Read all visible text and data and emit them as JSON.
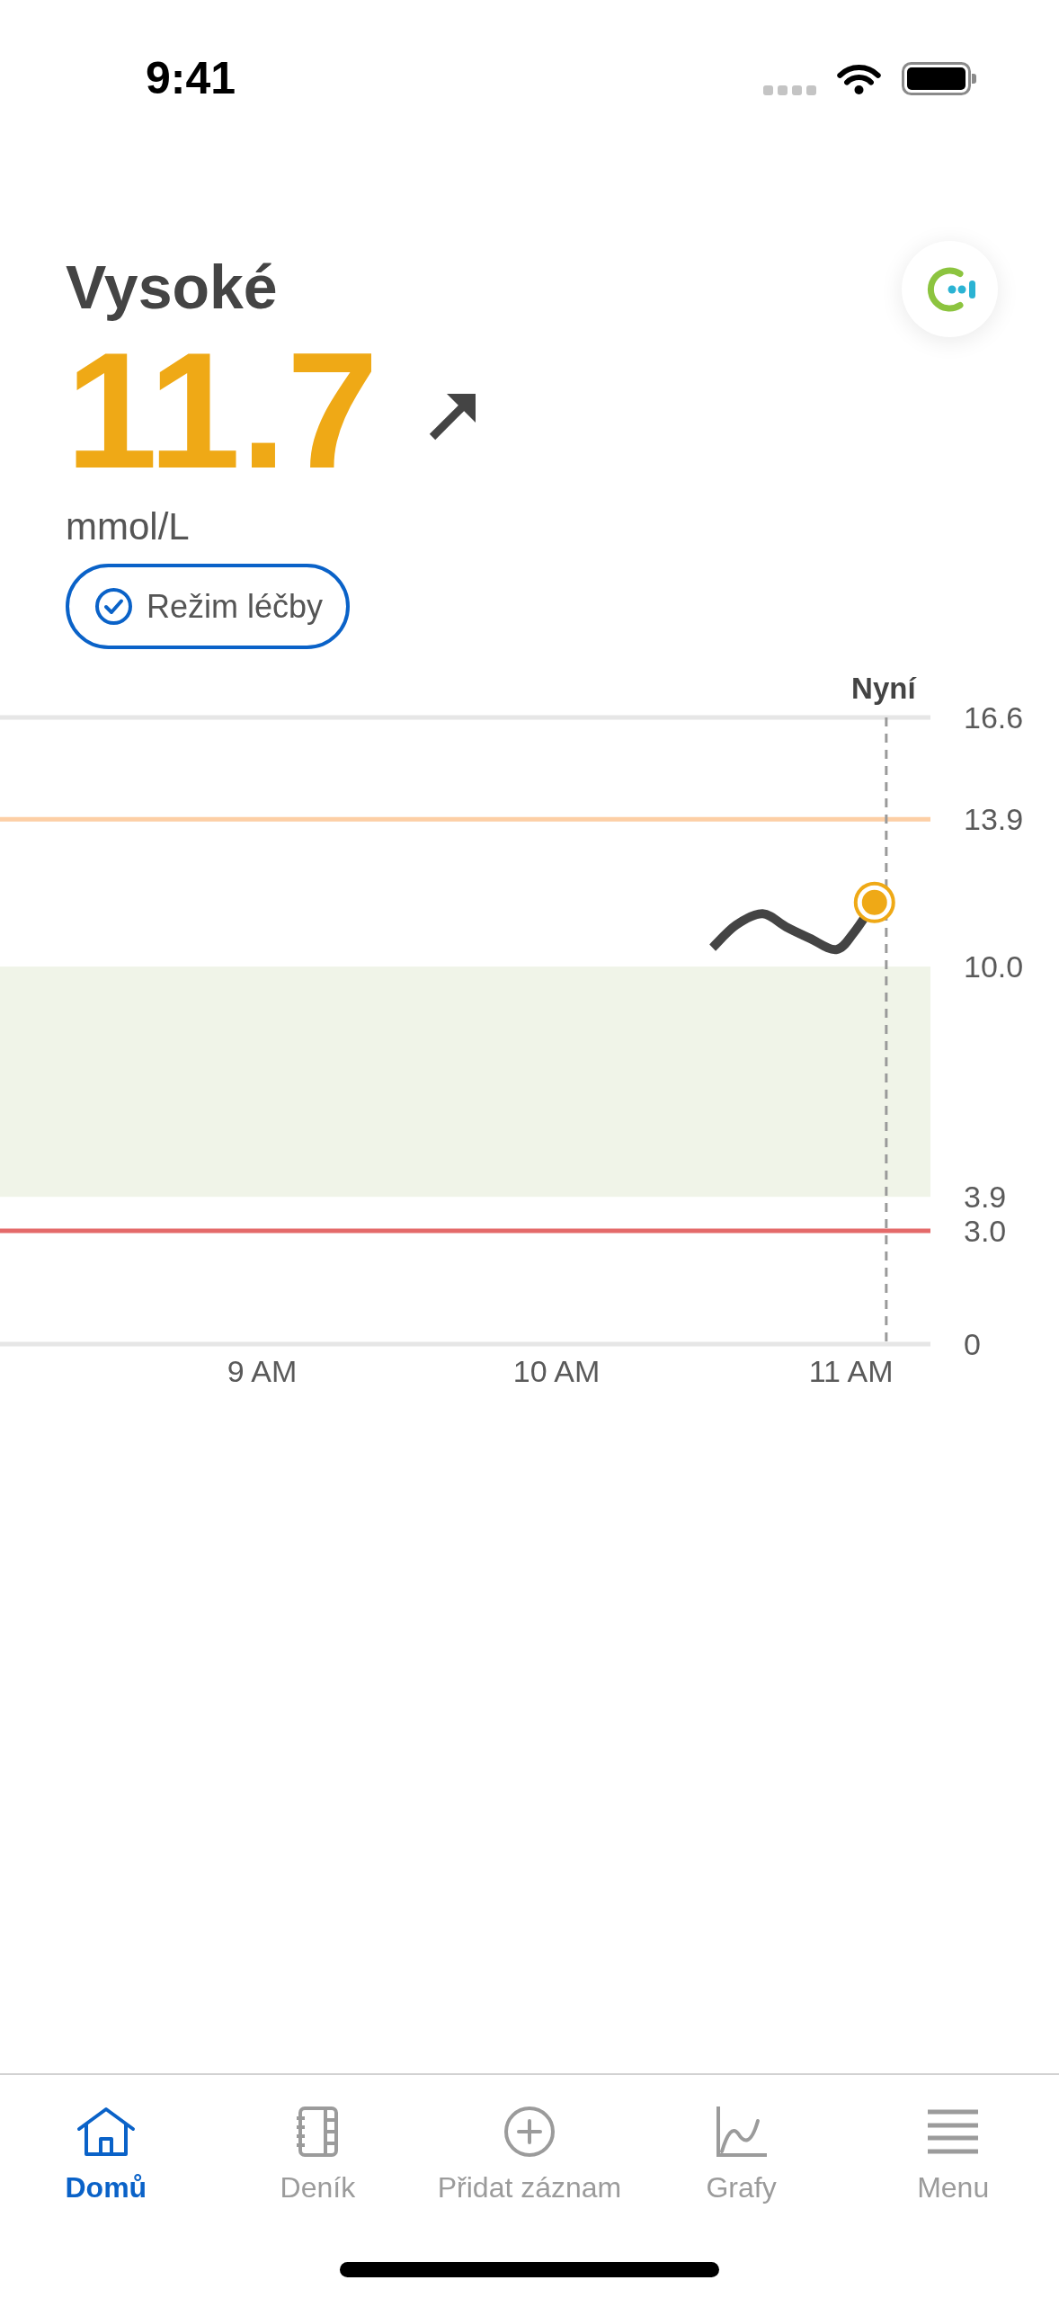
{
  "status_bar": {
    "time": "9:41"
  },
  "reading": {
    "status": "Vysoké",
    "value": "11.7",
    "unit": "mmol/L"
  },
  "mode_button": {
    "label": "Režim léčby"
  },
  "chart": {
    "chart_data": {
      "type": "line",
      "x": [
        10.53,
        10.61,
        10.7,
        10.78,
        10.86,
        10.95,
        11.01,
        11.08
      ],
      "series": [
        {
          "color": "#444444",
          "values": [
            10.5,
            11.1,
            11.4,
            11.05,
            10.75,
            10.45,
            10.9,
            11.7
          ]
        },
        {
          "type": "scatter",
          "color": "#efa916",
          "values": [
            null,
            null,
            null,
            null,
            null,
            null,
            null,
            11.7
          ]
        }
      ],
      "xlim": [
        8.11,
        11.27
      ],
      "ylim": [
        0,
        16.6
      ],
      "xticks": [
        {
          "value": 9,
          "label": "9 AM"
        },
        {
          "value": 10,
          "label": "10 AM"
        },
        {
          "value": 11,
          "label": "11 AM"
        }
      ],
      "yticks": [
        {
          "value": 16.6,
          "label": "16.6"
        },
        {
          "value": 13.9,
          "label": "13.9"
        },
        {
          "value": 10,
          "label": "10.0"
        },
        {
          "value": 3.9,
          "label": "3.9"
        },
        {
          "value": 3,
          "label": "3.0"
        },
        0
      ],
      "bands": [
        {
          "axis": "y",
          "from": 3.9,
          "to": 10,
          "color": "#f0f4e8"
        }
      ],
      "ref_lines": [
        {
          "axis": "y",
          "value": 13.9,
          "color": "#fdcfa5"
        },
        {
          "axis": "y",
          "value": 3,
          "color": "#e46a6a"
        },
        {
          "axis": "x",
          "value": 11.12,
          "label": "Nyní",
          "color": "#9a9a9a"
        }
      ]
    }
  },
  "tab_bar": [
    {
      "label": "Domů",
      "selected": true
    },
    {
      "label": "Deník",
      "selected": false
    },
    {
      "label": "Přidat záznam",
      "selected": false
    },
    {
      "label": "Grafy",
      "selected": false
    },
    {
      "label": "Menu",
      "selected": false
    }
  ]
}
